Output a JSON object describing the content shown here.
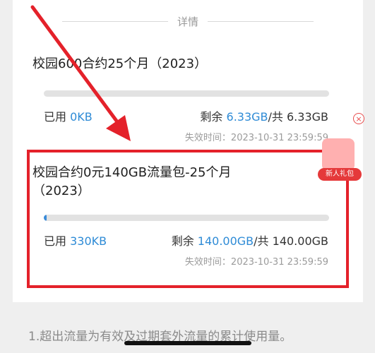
{
  "header": {
    "title": "详情"
  },
  "plans": [
    {
      "name": "校园600合约25个月（2023）",
      "used_label": "已用 ",
      "used_value": "0KB",
      "remain_label": "剩余 ",
      "remain_value": "6.33GB",
      "total": "/共 6.33GB",
      "expiry_label": "失效时间：",
      "expiry": "2023-10-31 23:59:59",
      "usage_fraction": 0.0
    },
    {
      "name_line1": "校园合约0元140GB流量包-25个月",
      "name_line2": "（2023）",
      "used_label": "已用 ",
      "used_value": "330KB",
      "remain_label": "剩余 ",
      "remain_value": "140.00GB",
      "total": "/共 140.00GB",
      "expiry_label": "失效时间：",
      "expiry": "2023-10-31 23:59:59",
      "usage_fraction": 0.005
    }
  ],
  "promo": {
    "label": "新人礼包"
  },
  "note": "1.超出流量为有效及过期套外流量的累计使用量。",
  "colors": {
    "accent": "#2e8bd6",
    "highlight": "#e4212a"
  }
}
